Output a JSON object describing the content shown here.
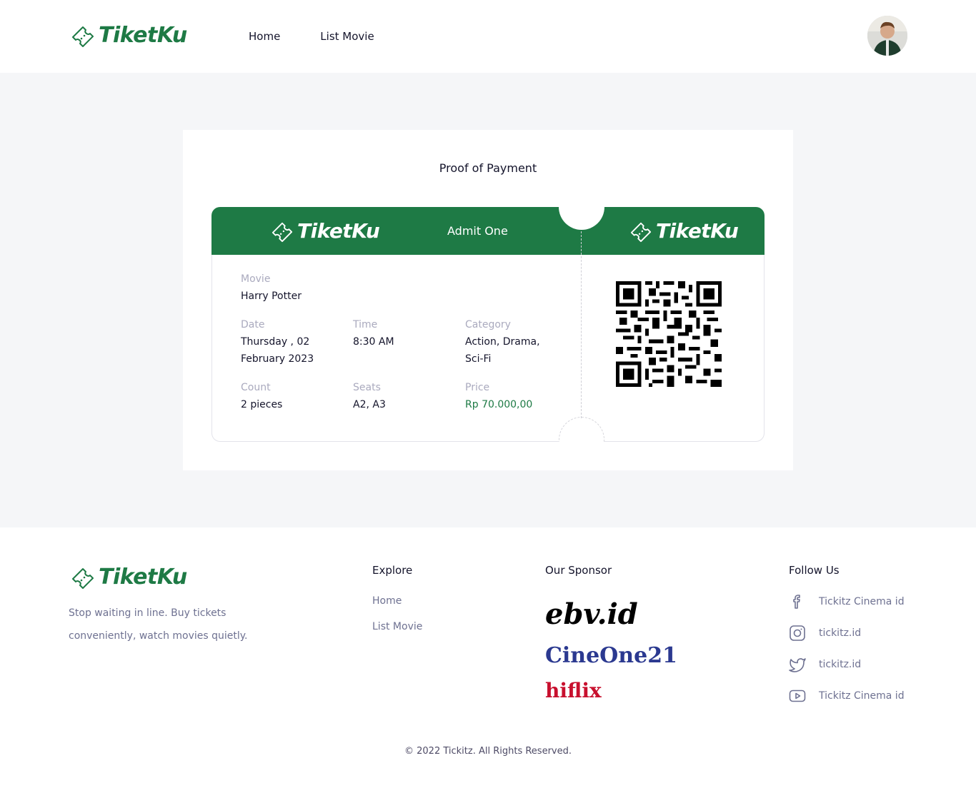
{
  "brand": {
    "name": "TiketKu",
    "color": "#1e7a45"
  },
  "header": {
    "nav": [
      {
        "label": "Home"
      },
      {
        "label": "List Movie"
      }
    ],
    "avatar_icon": "user-avatar"
  },
  "card": {
    "title": "Proof of Payment",
    "ticket": {
      "admit": "Admit One",
      "movie": {
        "label": "Movie",
        "value": "Harry Potter"
      },
      "date": {
        "label": "Date",
        "value_line1": "Thursday , 02",
        "value_line2": "February 2023"
      },
      "time": {
        "label": "Time",
        "value": "8:30 AM"
      },
      "category": {
        "label": "Category",
        "value_line1": "Action, Drama,",
        "value_line2": "Sci-Fi"
      },
      "count": {
        "label": "Count",
        "value": "2 pieces"
      },
      "seats": {
        "label": "Seats",
        "value": "A2, A3"
      },
      "price": {
        "label": "Price",
        "value": "Rp 70.000,00"
      },
      "qr_icon": "qr-code"
    }
  },
  "footer": {
    "tagline_line1": "Stop waiting in line. Buy tickets",
    "tagline_line2": "conveniently, watch movies quietly.",
    "explore": {
      "title": "Explore",
      "links": [
        {
          "label": "Home"
        },
        {
          "label": "List Movie"
        }
      ]
    },
    "sponsor": {
      "title": "Our Sponsor",
      "names": [
        "ebv.id",
        "CineOne21",
        "hiflix"
      ],
      "colors": [
        "#000000",
        "#2b3990",
        "#c8102e"
      ]
    },
    "follow": {
      "title": "Follow Us",
      "items": [
        {
          "icon": "facebook-icon",
          "label": "Tickitz Cinema id"
        },
        {
          "icon": "instagram-icon",
          "label": "tickitz.id"
        },
        {
          "icon": "twitter-icon",
          "label": "tickitz.id"
        },
        {
          "icon": "youtube-icon",
          "label": "Tickitz Cinema id"
        }
      ]
    },
    "copyright": "© 2022 Tickitz. All Rights Reserved."
  }
}
